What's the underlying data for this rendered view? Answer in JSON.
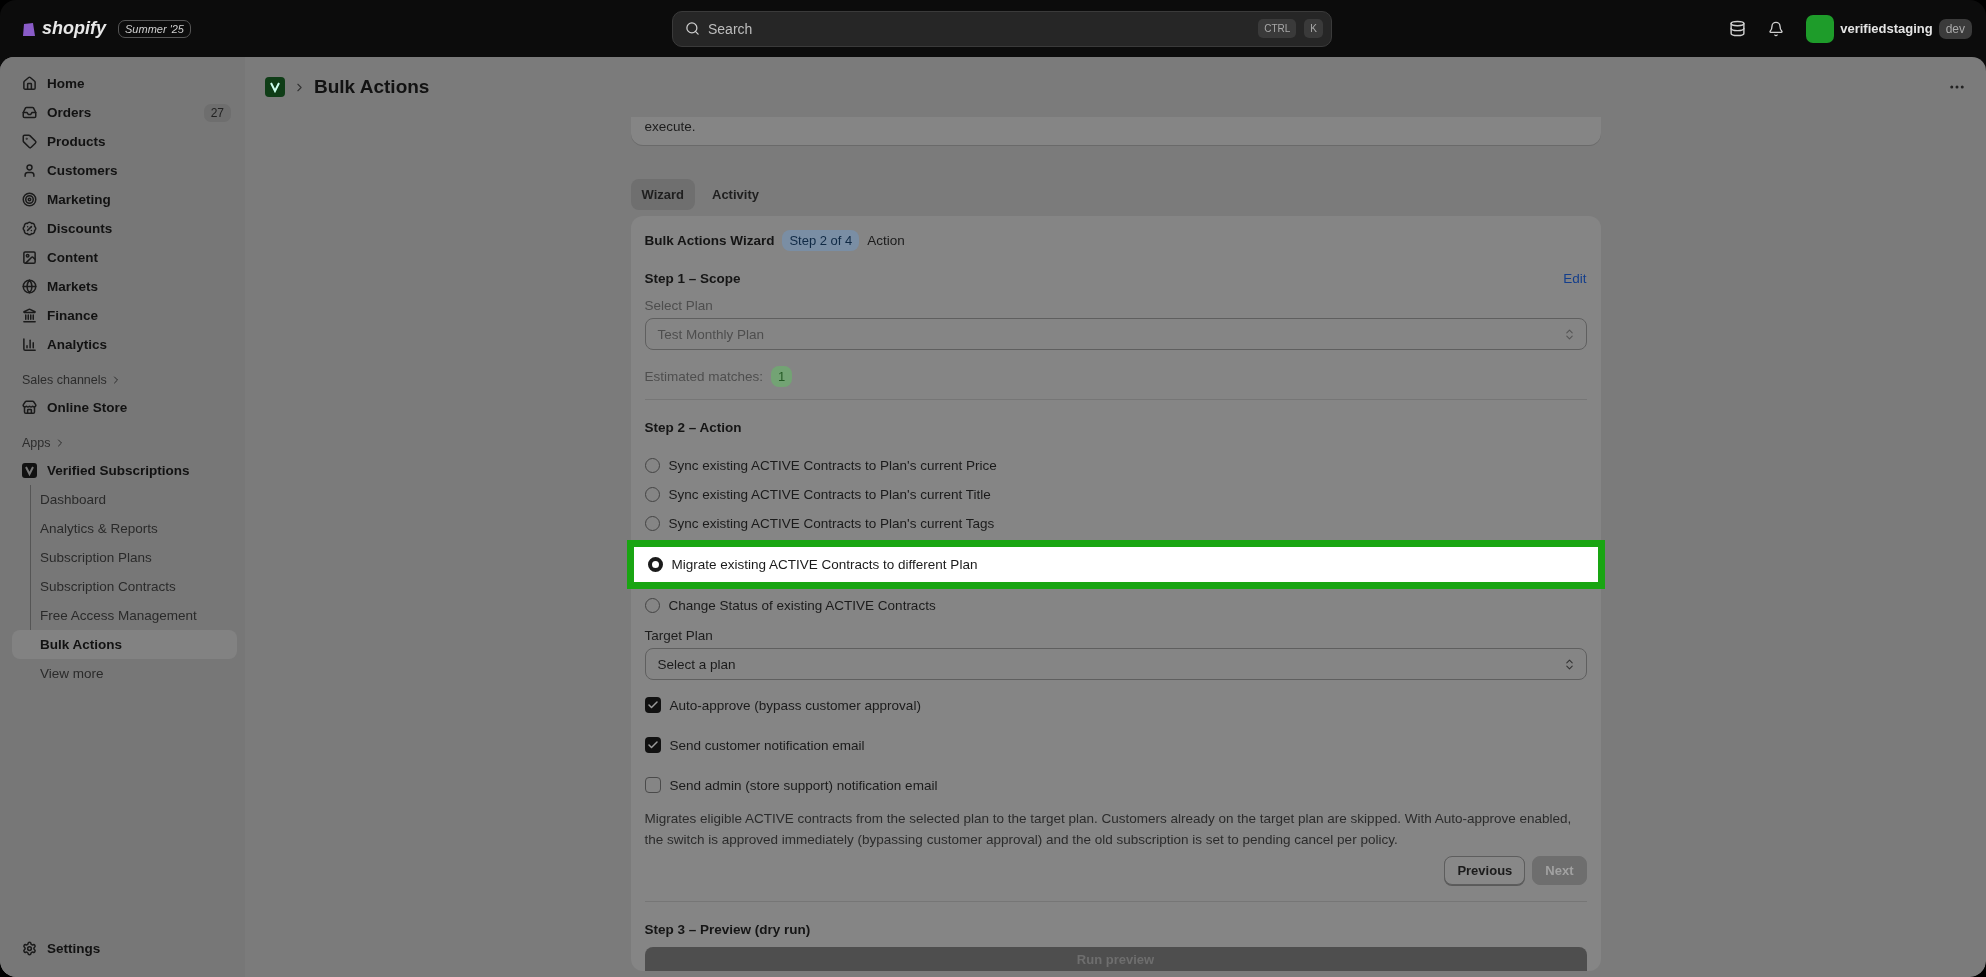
{
  "topbar": {
    "logo": "shopify",
    "edition": "Summer '25",
    "search": {
      "placeholder": "Search",
      "keys": [
        "CTRL",
        "K"
      ]
    },
    "account": {
      "name": "verifiedstaging",
      "badge": "dev"
    }
  },
  "sidebar": {
    "items": [
      {
        "label": "Home"
      },
      {
        "label": "Orders",
        "count": "27"
      },
      {
        "label": "Products"
      },
      {
        "label": "Customers"
      },
      {
        "label": "Marketing"
      },
      {
        "label": "Discounts"
      },
      {
        "label": "Content"
      },
      {
        "label": "Markets"
      },
      {
        "label": "Finance"
      },
      {
        "label": "Analytics"
      }
    ],
    "sales_channels": {
      "title": "Sales channels",
      "items": [
        {
          "label": "Online Store"
        }
      ]
    },
    "apps": {
      "title": "Apps",
      "app": {
        "label": "Verified Subscriptions",
        "children": [
          {
            "label": "Dashboard",
            "selected": false
          },
          {
            "label": "Analytics & Reports",
            "selected": false
          },
          {
            "label": "Subscription Plans",
            "selected": false
          },
          {
            "label": "Subscription Contracts",
            "selected": false
          },
          {
            "label": "Free Access Management",
            "selected": false
          },
          {
            "label": "Bulk Actions",
            "selected": true
          }
        ]
      },
      "more": "View more"
    },
    "settings": "Settings"
  },
  "page": {
    "title": "Bulk Actions",
    "intro_tail": "execute.",
    "tabs": [
      {
        "label": "Wizard",
        "selected": true
      },
      {
        "label": "Activity",
        "selected": false
      }
    ],
    "wizard": {
      "title": "Bulk Actions Wizard",
      "step_badge": "Step 2 of 4",
      "step_name": "Action",
      "step1": {
        "title": "Step 1 – Scope",
        "edit": "Edit",
        "select_label": "Select Plan",
        "select_value": "Test Monthly Plan",
        "matches_label": "Estimated matches:",
        "matches": "1"
      },
      "step2": {
        "title": "Step 2 – Action",
        "options": [
          {
            "label": "Sync existing ACTIVE Contracts to Plan's current Price",
            "selected": false,
            "highlighted": false
          },
          {
            "label": "Sync existing ACTIVE Contracts to Plan's current Title",
            "selected": false,
            "highlighted": false
          },
          {
            "label": "Sync existing ACTIVE Contracts to Plan's current Tags",
            "selected": false,
            "highlighted": false
          },
          {
            "label": "Migrate existing ACTIVE Contracts to different Plan",
            "selected": true,
            "highlighted": true
          },
          {
            "label": "Change Status of existing ACTIVE Contracts",
            "selected": false,
            "highlighted": false
          }
        ],
        "target_label": "Target Plan",
        "target_value": "Select a plan",
        "checkboxes": [
          {
            "label": "Auto-approve (bypass customer approval)",
            "checked": true
          },
          {
            "label": "Send customer notification email",
            "checked": true
          },
          {
            "label": "Send admin (store support) notification email",
            "checked": false
          }
        ],
        "description": "Migrates eligible ACTIVE contracts from the selected plan to the target plan. Customers already on the target plan are skipped. With Auto-approve enabled, the switch is approved immediately (bypassing customer approval) and the old subscription is set to pending cancel per policy.",
        "buttons": [
          {
            "label": "Previous",
            "disabled": false
          },
          {
            "label": "Next",
            "disabled": true
          }
        ]
      },
      "step3": {
        "title": "Step 3 – Preview (dry run)",
        "button": "Run preview"
      }
    }
  }
}
